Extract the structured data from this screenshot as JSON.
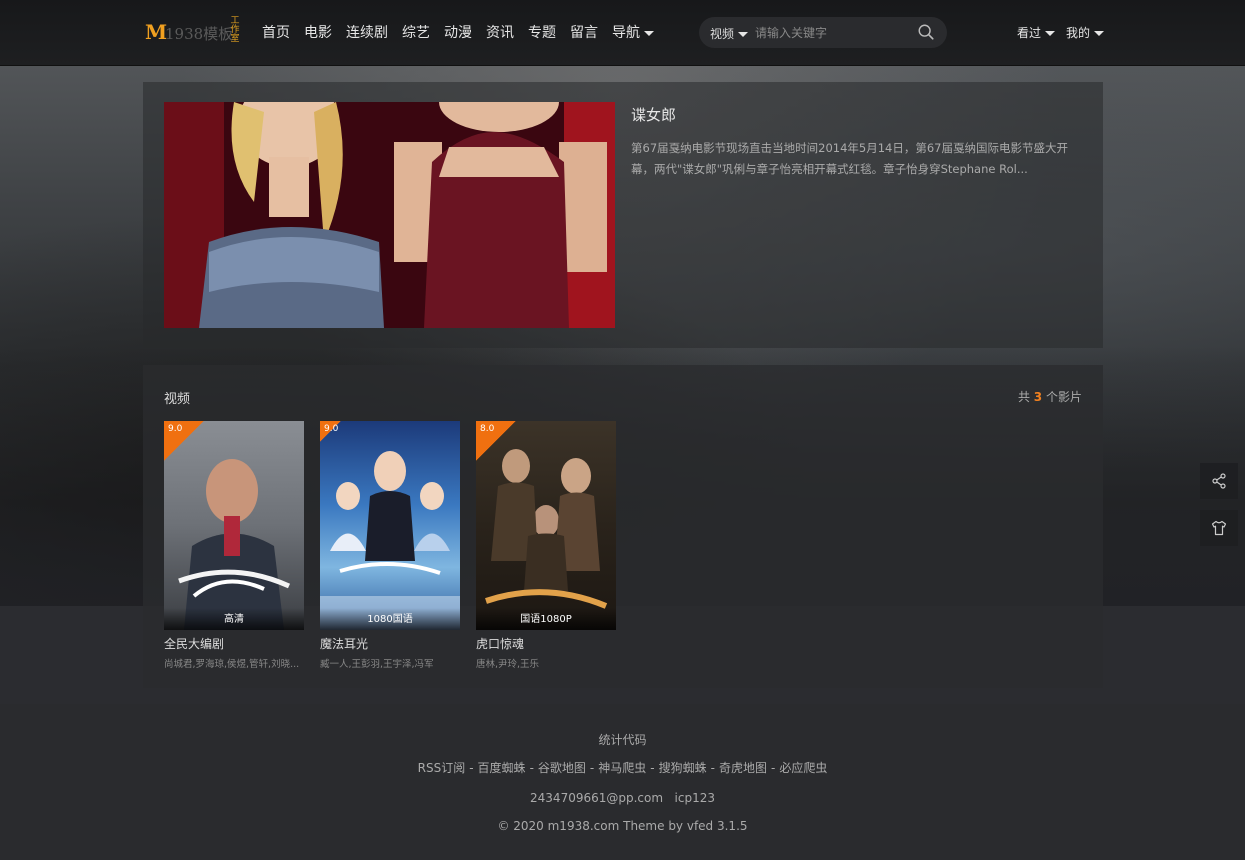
{
  "header": {
    "logo": {
      "m": "M",
      "rest": "1938模板",
      "badge": "工作室"
    },
    "nav": [
      {
        "label": "首页"
      },
      {
        "label": "电影"
      },
      {
        "label": "连续剧"
      },
      {
        "label": "综艺"
      },
      {
        "label": "动漫"
      },
      {
        "label": "资讯"
      },
      {
        "label": "专题"
      },
      {
        "label": "留言"
      },
      {
        "label": "导航"
      }
    ],
    "search": {
      "category": "视频",
      "placeholder": "请输入关键字"
    },
    "user": {
      "history": "看过",
      "mine": "我的"
    }
  },
  "featured": {
    "title": "谍女郎",
    "description": "第67届戛纳电影节现场直击当地时间2014年5月14日，第67届戛纳国际电影节盛大开幕，两代\"谍女郎\"巩俐与章子怡亮相开幕式红毯。章子怡身穿Stephane Rol..."
  },
  "videos": {
    "section_title": "视频",
    "count_prefix": "共",
    "count": "3",
    "count_suffix": "个影片",
    "items": [
      {
        "score": "9.0",
        "note": "高清",
        "title": "全民大编剧",
        "actors": "尚城君,罗海琼,侯煜,管轩,刘晓..."
      },
      {
        "score": "9.0",
        "note": "1080国语",
        "title": "魔法耳光",
        "actors": "臧一人,王彭羽,王宇泽,冯军"
      },
      {
        "score": "8.0",
        "note": "国语1080P",
        "title": "虎口惊魂",
        "actors": "唐林,尹玲,王乐"
      }
    ]
  },
  "footer": {
    "stats": "统计代码",
    "links": [
      "RSS订阅",
      "百度蜘蛛",
      "谷歌地图",
      "神马爬虫",
      "搜狗蜘蛛",
      "奇虎地图",
      "必应爬虫"
    ],
    "email": "2434709661@pp.com",
    "icp": "icp123",
    "copyright": "© 2020 m1938.com Theme by vfed 3.1.5"
  },
  "colors": {
    "accent": "#f07010",
    "background": "#2b2c30",
    "header": "#1b1c1e"
  },
  "icons": {
    "search": "search-icon",
    "share": "share-icon",
    "theme": "tshirt-icon"
  }
}
